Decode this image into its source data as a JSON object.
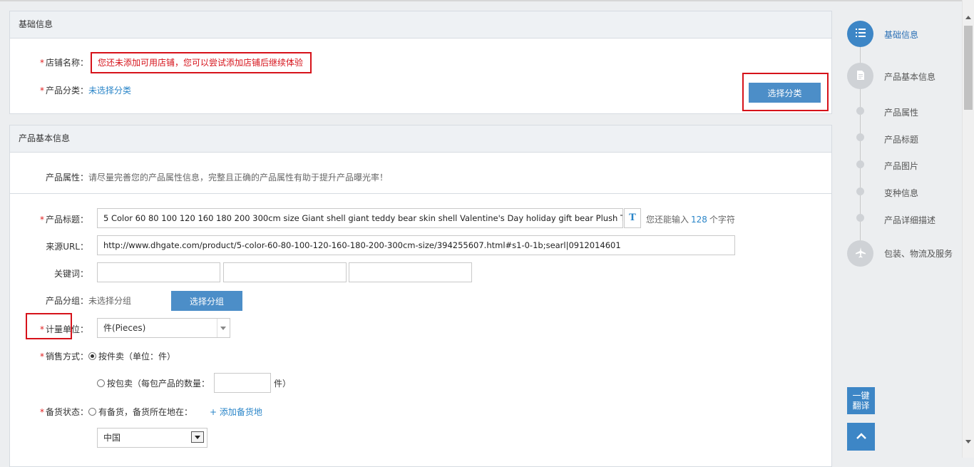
{
  "panel_basic": {
    "title": "基础信息",
    "shop_label": "店铺名称：",
    "shop_warning": "您还未添加可用店铺，您可以尝试添加店铺后继续体验",
    "category_label": "产品分类：",
    "category_value": "未选择分类",
    "select_category_button": "选择分类"
  },
  "panel_product": {
    "title": "产品基本信息",
    "attr_label": "产品属性：",
    "attr_hint": "请尽量完善您的产品属性信息，完整且正确的产品属性有助于提升产品曝光率！",
    "title_label": "产品标题：",
    "title_value": "5 Color 60 80 100 120 160 180 200 300cm size Giant shell giant teddy bear skin shell Valentine's Day holiday gift bear Plush Toys B",
    "title_format_button": "T",
    "remaining_prefix": "您还能输入",
    "remaining_count": "128",
    "remaining_suffix": "个字符",
    "source_url_label": "来源URL：",
    "source_url_value": "http://www.dhgate.com/product/5-color-60-80-100-120-160-180-200-300cm-size/394255607.html#s1-0-1b;searl|0912014601",
    "keywords_label": "关键词：",
    "keywords": [
      "",
      "",
      ""
    ],
    "group_label": "产品分组：",
    "group_value": "未选择分组",
    "select_group_button": "选择分组",
    "unit_label": "计量单位：",
    "unit_value": "件(Pieces)",
    "sale_label": "销售方式：",
    "sale_option_piece": "按件卖（单位：件）",
    "sale_option_pack": "按包卖（每包产品的数量：",
    "pack_unit": "件）",
    "stock_label": "备货状态：",
    "stock_option": "有备货，备货所在地在：",
    "add_stock_location": "+ 添加备货地",
    "country_value": "中国"
  },
  "steps": [
    {
      "label": "基础信息",
      "active": true,
      "icon": "list-icon"
    },
    {
      "label": "产品基本信息",
      "active": false,
      "icon": "document-icon"
    },
    {
      "label": "产品属性",
      "active": false
    },
    {
      "label": "产品标题",
      "active": false
    },
    {
      "label": "产品图片",
      "active": false
    },
    {
      "label": "变种信息",
      "active": false
    },
    {
      "label": "产品详细描述",
      "active": false
    },
    {
      "label": "包装、物流及服务",
      "active": false,
      "icon": "airplane-icon"
    }
  ],
  "side_buttons": {
    "translate_line1": "一键",
    "translate_line2": "翻译",
    "back_to_top_icon": "chevron-up-icon"
  },
  "colors": {
    "accent": "#3d86c6",
    "required": "#e02020",
    "annotation_red": "#d6121a",
    "link": "#2a85c8"
  }
}
